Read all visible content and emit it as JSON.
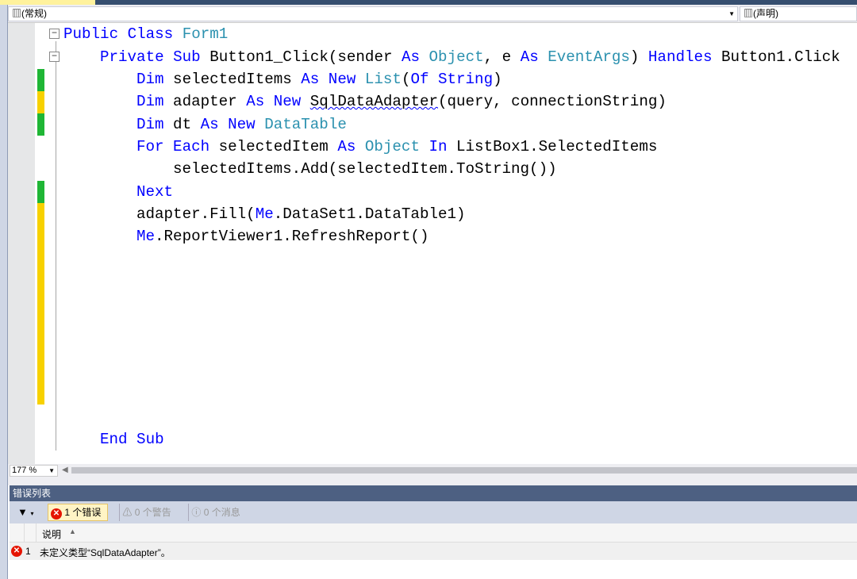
{
  "nav": {
    "left_dropdown": "(常规)",
    "right_dropdown": "(声明)"
  },
  "code": {
    "l1": [
      "Public",
      " Class ",
      "Form1"
    ],
    "l2": {
      "a": "Private Sub ",
      "b": "Button1_Click(sender ",
      "c": "As ",
      "d": "Object",
      "e": ", e ",
      "f": "As ",
      "g": "EventArgs",
      ")": ") ",
      "h": "Handles",
      " i": " Button1.Click"
    },
    "l3": [
      "Dim",
      " selectedItems ",
      "As New ",
      "List",
      "(",
      "Of String",
      ")"
    ],
    "l4": [
      "Dim",
      " adapter ",
      "As New ",
      "SqlDataAdapter",
      "(query, connectionString)"
    ],
    "l5": [
      "Dim",
      " dt ",
      "As New ",
      "DataTable"
    ],
    "l6": [
      "For Each",
      " selectedItem ",
      "As ",
      "Object",
      " ",
      "In",
      " ListBox1.SelectedItems"
    ],
    "l7": "selectedItems.Add(selectedItem.ToString())",
    "l8": "Next",
    "l9": [
      "adapter.Fill(",
      "Me",
      ".DataSet1.DataTable1)"
    ],
    "l10": [
      "Me",
      ".ReportViewer1.RefreshReport()"
    ],
    "l19": "End Sub"
  },
  "zoom": "177 %",
  "error_list": {
    "title": "错误列表",
    "errors": "1 个错误",
    "warnings": "0 个警告",
    "messages": "0 个消息",
    "col_desc": "说明",
    "rows": [
      {
        "num": "1",
        "desc": "未定义类型“SqlDataAdapter”。"
      }
    ]
  },
  "colors": {
    "keyword": "#0000ff",
    "type": "#2b91af",
    "changed_saved": "#1fb635",
    "changed_unsaved": "#f7d100"
  }
}
